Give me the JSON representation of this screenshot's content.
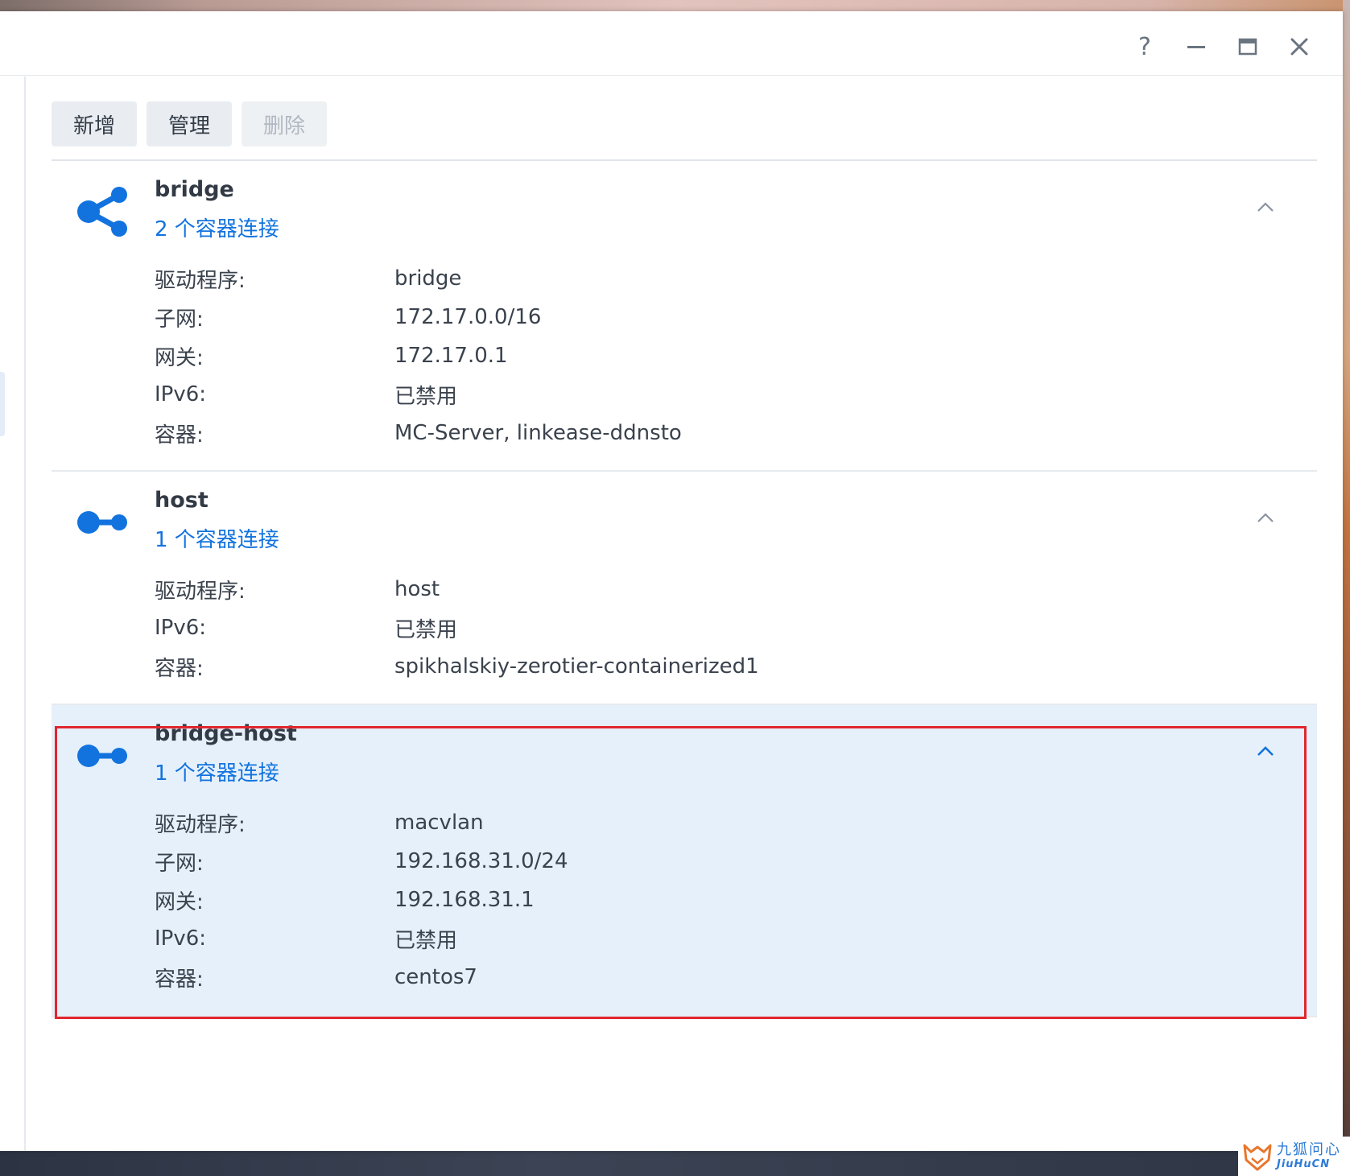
{
  "window": {
    "controls": {
      "help_label": "?"
    }
  },
  "toolbar": {
    "add_label": "新增",
    "manage_label": "管理",
    "delete_label": "删除"
  },
  "colors": {
    "accent": "#1273de",
    "highlight": "#e0262f",
    "selected_bg": "#e6f0fb"
  },
  "networks": [
    {
      "name": "bridge",
      "connections": "2 个容器连接",
      "icon": "share-icon",
      "expanded": true,
      "properties": [
        {
          "label": "驱动程序:",
          "value": "bridge"
        },
        {
          "label": "子网:",
          "value": "172.17.0.0/16"
        },
        {
          "label": "网关:",
          "value": "172.17.0.1"
        },
        {
          "label": "IPv6:",
          "value": "已禁用"
        },
        {
          "label": "容器:",
          "value": "MC-Server, linkease-ddnsto"
        }
      ]
    },
    {
      "name": "host",
      "connections": "1 个容器连接",
      "icon": "link-icon",
      "expanded": true,
      "properties": [
        {
          "label": "驱动程序:",
          "value": "host"
        },
        {
          "label": "IPv6:",
          "value": "已禁用"
        },
        {
          "label": "容器:",
          "value": "spikhalskiy-zerotier-containerized1"
        }
      ]
    },
    {
      "name": "bridge-host",
      "connections": "1 个容器连接",
      "icon": "link-icon",
      "expanded": true,
      "selected": true,
      "properties": [
        {
          "label": "驱动程序:",
          "value": "macvlan"
        },
        {
          "label": "子网:",
          "value": "192.168.31.0/24"
        },
        {
          "label": "网关:",
          "value": "192.168.31.1"
        },
        {
          "label": "IPv6:",
          "value": "已禁用"
        },
        {
          "label": "容器:",
          "value": "centos7"
        }
      ]
    }
  ],
  "watermark": {
    "cn": "九狐问心",
    "en": "JiuHuCN"
  }
}
